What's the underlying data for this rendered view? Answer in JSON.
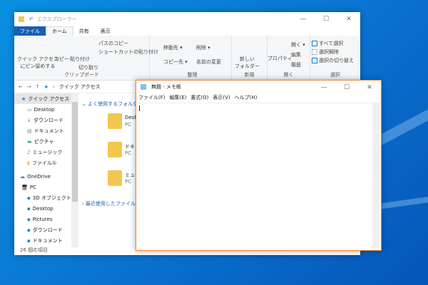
{
  "explorer": {
    "title": "エクスプローラー",
    "tabs": [
      "ファイル",
      "ホーム",
      "共有",
      "表示"
    ],
    "ribbon": {
      "clipboard": {
        "pin": "クイック アクセス\nにピン留めする",
        "copy": "コピー",
        "paste": "貼り付け",
        "copy_path": "パスのコピー",
        "paste_shortcut": "ショートカットの貼り付け",
        "cut": "切り取り",
        "label": "クリップボード"
      },
      "organize": {
        "move": "移動先 ▾",
        "copy_to": "コピー先 ▾",
        "delete": "削除 ▾",
        "rename": "名前の変更",
        "label": "整理"
      },
      "new": {
        "new_folder": "新しい\nフォルダー",
        "label": "新規"
      },
      "open": {
        "properties": "プロパティ",
        "open": "開く ▾",
        "edit": "編集",
        "history": "履歴",
        "label": "開く"
      },
      "select": {
        "all": "すべて選択",
        "none": "選択解除",
        "invert": "選択の切り替え",
        "label": "選択"
      }
    },
    "address": "クイック アクセス",
    "nav": {
      "quick_access": "クイック アクセス",
      "items": [
        "Desktop",
        "ダウンロード",
        "ドキュメント",
        "ピクチャ",
        "ミュージック",
        "ファイル①"
      ],
      "onedrive": "OneDrive",
      "pc": "PC",
      "pc_items": [
        "3D オブジェクト",
        "Desktop",
        "Pictures",
        "ダウンロード",
        "ドキュメント"
      ]
    },
    "content": {
      "frequent": "よく使用するフォルダー",
      "folders": [
        {
          "name": "Desktop",
          "loc": "PC"
        },
        {
          "name": "ドキュメント",
          "loc": "PC"
        },
        {
          "name": "ミュージック",
          "loc": "PC"
        }
      ],
      "recent": "最近使用したファイル"
    },
    "status": "26 個の項目"
  },
  "notepad": {
    "title": "無題 - メモ帳",
    "menu": [
      "ファイル(F)",
      "編集(E)",
      "書式(O)",
      "表示(V)",
      "ヘルプ(H)"
    ]
  }
}
